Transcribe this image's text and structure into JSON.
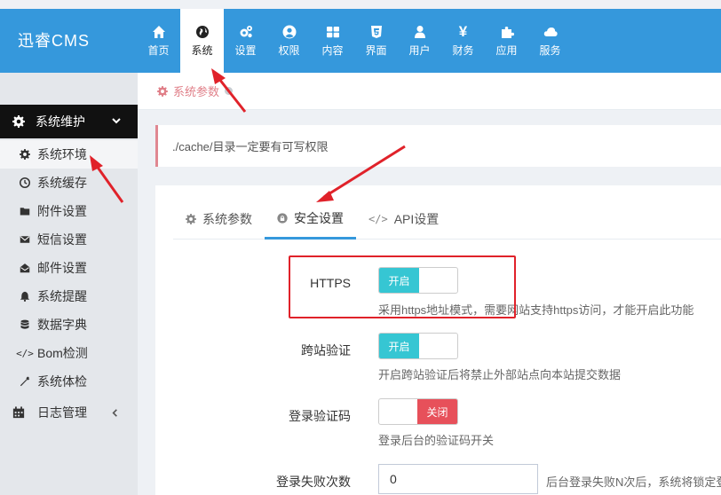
{
  "app": {
    "title": "迅睿CMS"
  },
  "nav": [
    {
      "label": "首页",
      "icon": "home-icon"
    },
    {
      "label": "系统",
      "icon": "globe-icon",
      "active": true
    },
    {
      "label": "设置",
      "icon": "gears-icon"
    },
    {
      "label": "权限",
      "icon": "user-circle-icon"
    },
    {
      "label": "内容",
      "icon": "grid-icon"
    },
    {
      "label": "界面",
      "icon": "html5-icon"
    },
    {
      "label": "用户",
      "icon": "user-icon"
    },
    {
      "label": "财务",
      "icon": "yen-icon"
    },
    {
      "label": "应用",
      "icon": "puzzle-icon"
    },
    {
      "label": "服务",
      "icon": "cloud-icon"
    }
  ],
  "sidebar": {
    "group": {
      "label": "系统维护",
      "icon": "gear-icon"
    },
    "items": [
      {
        "label": "系统环境",
        "icon": "gear-icon"
      },
      {
        "label": "系统缓存",
        "icon": "clock-icon"
      },
      {
        "label": "附件设置",
        "icon": "folder-icon"
      },
      {
        "label": "短信设置",
        "icon": "envelope-icon"
      },
      {
        "label": "邮件设置",
        "icon": "envelope-open-icon"
      },
      {
        "label": "系统提醒",
        "icon": "bell-icon"
      },
      {
        "label": "数据字典",
        "icon": "database-icon"
      },
      {
        "label": "Bom检测",
        "icon": "code-icon"
      },
      {
        "label": "系统体检",
        "icon": "wrench-icon"
      }
    ],
    "log": {
      "label": "日志管理",
      "icon": "calendar-icon"
    }
  },
  "breadcrumb": {
    "label": "系统参数"
  },
  "notice": {
    "text": "./cache/目录一定要有可写权限"
  },
  "tabs": [
    {
      "label": "系统参数",
      "icon": "gear-icon"
    },
    {
      "label": "安全设置",
      "icon": "lock-icon",
      "active": true
    },
    {
      "label": "API设置",
      "icon": "code-icon"
    }
  ],
  "form": {
    "https": {
      "label": "HTTPS",
      "on_label": "开启",
      "help": "采用https地址模式，需要网站支持https访问，才能开启此功能"
    },
    "csrf": {
      "label": "跨站验证",
      "on_label": "开启",
      "help": "开启跨站验证后将禁止外部站点向本站提交数据"
    },
    "captcha": {
      "label": "登录验证码",
      "off_label": "关闭",
      "help": "登录后台的验证码开关"
    },
    "login_fail": {
      "label": "登录失败次数",
      "value": "0",
      "help": "后台登录失败N次后，系统将锁定登"
    }
  },
  "colors": {
    "header": "#3598dc",
    "switch_on": "#36c6d3",
    "switch_off": "#e7505a",
    "annotation": "#e0222a"
  }
}
